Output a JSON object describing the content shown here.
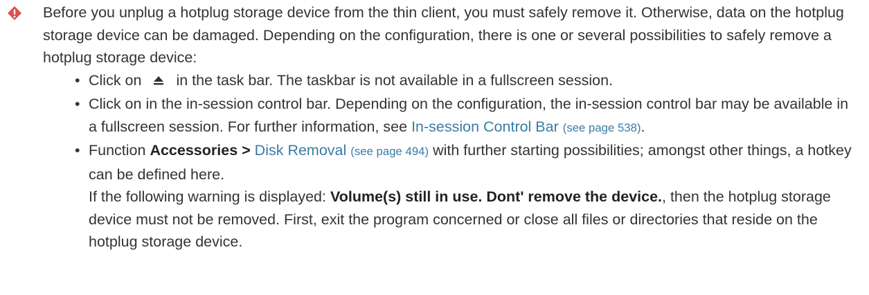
{
  "note": {
    "icon": "diamond-warning-icon",
    "icon_color": "#d9534f",
    "intro": "Before you unplug a hotplug storage device from the thin client, you must safely remove it. Otherwise, data on the hotplug storage device can be damaged. Depending on the configuration, there is one or several possibilities to safely remove a hotplug storage device:",
    "items": [
      {
        "prefix": "Click on",
        "icon": "eject-icon",
        "suffix": "in the task bar. The taskbar is not available in a fullscreen session."
      },
      {
        "text": "Click on in the in-session control bar. Depending on the configuration, the in-session control bar may be available in a fullscreen session. For further information, see",
        "link": "In-session Control Bar",
        "pageref": "(see page 538)",
        "end": "."
      },
      {
        "prefix": "Function",
        "bold": "Accessories >",
        "link": "Disk Removal",
        "pageref": "(see page 494)",
        "suffix": "with further starting possibilities; amongst other things, a hotkey can be defined here.",
        "warn_prefix": "If the following warning is displayed:",
        "warn_bold": "Volume(s) still in use. Dont' remove the device.",
        "warn_suffix": ", then the hotplug storage device must not be removed. First, exit the program concerned or close all files or directories that reside on the hotplug storage device."
      }
    ],
    "link_color": "#3a7ca5"
  }
}
